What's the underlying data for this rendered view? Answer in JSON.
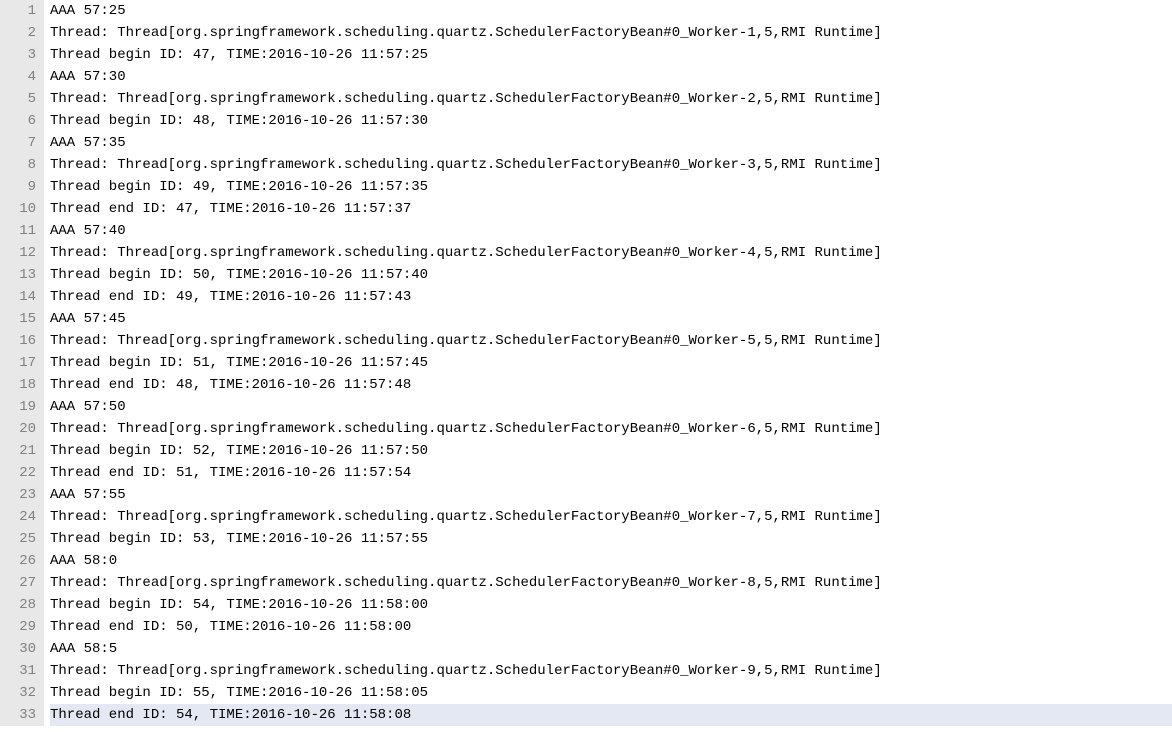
{
  "lines": [
    {
      "num": "1",
      "text": "AAA 57:25",
      "hl": false
    },
    {
      "num": "2",
      "text": "Thread: Thread[org.springframework.scheduling.quartz.SchedulerFactoryBean#0_Worker-1,5,RMI Runtime]",
      "hl": false
    },
    {
      "num": "3",
      "text": "Thread begin ID: 47, TIME:2016-10-26 11:57:25",
      "hl": false
    },
    {
      "num": "4",
      "text": "AAA 57:30",
      "hl": false
    },
    {
      "num": "5",
      "text": "Thread: Thread[org.springframework.scheduling.quartz.SchedulerFactoryBean#0_Worker-2,5,RMI Runtime]",
      "hl": false
    },
    {
      "num": "6",
      "text": "Thread begin ID: 48, TIME:2016-10-26 11:57:30",
      "hl": false
    },
    {
      "num": "7",
      "text": "AAA 57:35",
      "hl": false
    },
    {
      "num": "8",
      "text": "Thread: Thread[org.springframework.scheduling.quartz.SchedulerFactoryBean#0_Worker-3,5,RMI Runtime]",
      "hl": false
    },
    {
      "num": "9",
      "text": "Thread begin ID: 49, TIME:2016-10-26 11:57:35",
      "hl": false
    },
    {
      "num": "10",
      "text": "Thread end ID: 47, TIME:2016-10-26 11:57:37",
      "hl": false
    },
    {
      "num": "11",
      "text": "AAA 57:40",
      "hl": false
    },
    {
      "num": "12",
      "text": "Thread: Thread[org.springframework.scheduling.quartz.SchedulerFactoryBean#0_Worker-4,5,RMI Runtime]",
      "hl": false
    },
    {
      "num": "13",
      "text": "Thread begin ID: 50, TIME:2016-10-26 11:57:40",
      "hl": false
    },
    {
      "num": "14",
      "text": "Thread end ID: 49, TIME:2016-10-26 11:57:43",
      "hl": false
    },
    {
      "num": "15",
      "text": "AAA 57:45",
      "hl": false
    },
    {
      "num": "16",
      "text": "Thread: Thread[org.springframework.scheduling.quartz.SchedulerFactoryBean#0_Worker-5,5,RMI Runtime]",
      "hl": false
    },
    {
      "num": "17",
      "text": "Thread begin ID: 51, TIME:2016-10-26 11:57:45",
      "hl": false
    },
    {
      "num": "18",
      "text": "Thread end ID: 48, TIME:2016-10-26 11:57:48",
      "hl": false
    },
    {
      "num": "19",
      "text": "AAA 57:50",
      "hl": false
    },
    {
      "num": "20",
      "text": "Thread: Thread[org.springframework.scheduling.quartz.SchedulerFactoryBean#0_Worker-6,5,RMI Runtime]",
      "hl": false
    },
    {
      "num": "21",
      "text": "Thread begin ID: 52, TIME:2016-10-26 11:57:50",
      "hl": false
    },
    {
      "num": "22",
      "text": "Thread end ID: 51, TIME:2016-10-26 11:57:54",
      "hl": false
    },
    {
      "num": "23",
      "text": "AAA 57:55",
      "hl": false
    },
    {
      "num": "24",
      "text": "Thread: Thread[org.springframework.scheduling.quartz.SchedulerFactoryBean#0_Worker-7,5,RMI Runtime]",
      "hl": false
    },
    {
      "num": "25",
      "text": "Thread begin ID: 53, TIME:2016-10-26 11:57:55",
      "hl": false
    },
    {
      "num": "26",
      "text": "AAA 58:0",
      "hl": false
    },
    {
      "num": "27",
      "text": "Thread: Thread[org.springframework.scheduling.quartz.SchedulerFactoryBean#0_Worker-8,5,RMI Runtime]",
      "hl": false
    },
    {
      "num": "28",
      "text": "Thread begin ID: 54, TIME:2016-10-26 11:58:00",
      "hl": false
    },
    {
      "num": "29",
      "text": "Thread end ID: 50, TIME:2016-10-26 11:58:00",
      "hl": false
    },
    {
      "num": "30",
      "text": "AAA 58:5",
      "hl": false
    },
    {
      "num": "31",
      "text": "Thread: Thread[org.springframework.scheduling.quartz.SchedulerFactoryBean#0_Worker-9,5,RMI Runtime]",
      "hl": false
    },
    {
      "num": "32",
      "text": "Thread begin ID: 55, TIME:2016-10-26 11:58:05",
      "hl": false
    },
    {
      "num": "33",
      "text": "Thread end ID: 54, TIME:2016-10-26 11:58:08",
      "hl": true
    }
  ]
}
